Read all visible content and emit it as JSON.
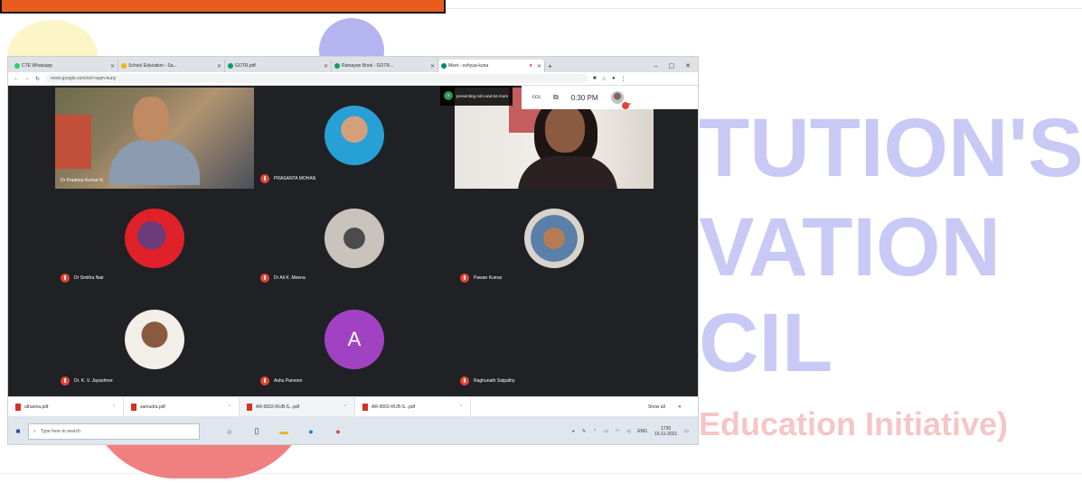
{
  "watermark": {
    "line1": "TUTION'S",
    "line2": "VATION",
    "line3": "CIL",
    "line4": "Education Initiative)"
  },
  "browser": {
    "tabs": [
      {
        "label": "CTE Whatsapp"
      },
      {
        "label": "School Education - Sa..."
      },
      {
        "label": "GOTR.pdf"
      },
      {
        "label": "Ramayan Book - GOTR..."
      },
      {
        "label": "Meet - oshyua-kuna"
      }
    ],
    "window_controls": {
      "minimize": "–",
      "maximize": "▢",
      "close": "✕"
    },
    "address": "meet.google.com/oof-raqm-huny"
  },
  "meet": {
    "caption_overlay": {
      "initial": "a",
      "text": "presenting Ashi and 54 more"
    },
    "clock": "0:30 PM",
    "clock_icons": {
      "ccs": "ccs",
      "screen": "⧉"
    },
    "you_label": "You",
    "participants": [
      {
        "name": "Dr Pradeep Kumar N",
        "kind": "video-1"
      },
      {
        "name": "PRASANTA MOHAN",
        "kind": "avatar-1"
      },
      {
        "name": "...",
        "kind": "video-2"
      },
      {
        "name": "Dr Smitha Nair",
        "kind": "avatar-2"
      },
      {
        "name": "Dr Ali K. Meena",
        "kind": "avatar-3"
      },
      {
        "name": "Pawan Kumar",
        "kind": "avatar-4"
      },
      {
        "name": "Dr. K. V. Jayashree",
        "kind": "avatar-5"
      },
      {
        "name": "Ashu Parveen",
        "kind": "letter",
        "letter": "A"
      },
      {
        "name": "Raghunath Satpathy",
        "kind": "video-3"
      }
    ]
  },
  "downloads": {
    "items": [
      {
        "label": "uthanna.pdf"
      },
      {
        "label": "samudra.pdf"
      },
      {
        "label": "AR-9502-RUB-S...pdf"
      },
      {
        "label": "AR-9502-RUB-S...pdf"
      }
    ],
    "show_all": "Show all",
    "close": "✕"
  },
  "taskbar": {
    "search_placeholder": "Type here to search",
    "tray_lang": "ENG",
    "tray_time": "1730",
    "tray_date": "15-11-2021"
  },
  "colors": {
    "banner": "#e85d1f",
    "watermark": "#c9c9f6",
    "meet_bg": "#202124",
    "mic_muted": "#ea4335",
    "letter_avatar": "#a142c3"
  }
}
